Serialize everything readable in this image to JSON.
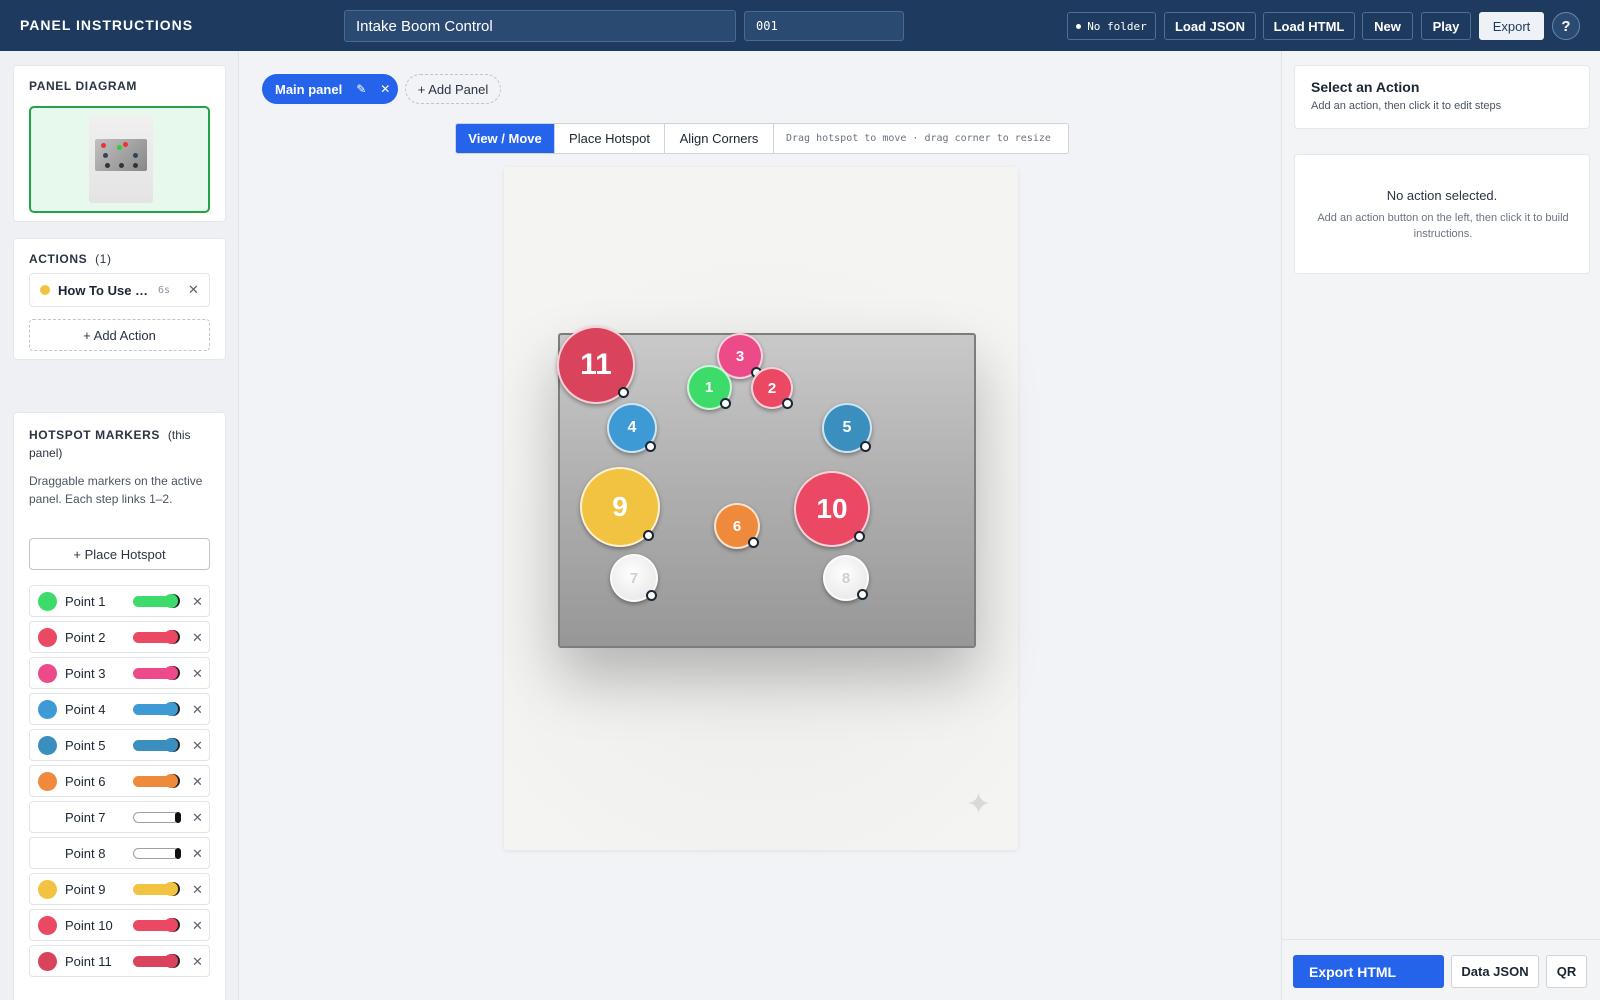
{
  "header": {
    "brand": "PANEL INSTRUCTIONS",
    "title_value": "Intake Boom Control",
    "id_value": "001",
    "folder": "No folder",
    "load_json": "Load JSON",
    "load_html": "Load HTML",
    "new": "New",
    "play": "Play",
    "export": "Export",
    "help": "?"
  },
  "left": {
    "diagram_title": "PANEL DIAGRAM",
    "actions_title": "ACTIONS",
    "actions_count": "(1)",
    "actions": [
      {
        "name": "How To Use This Panel",
        "duration": "6s"
      }
    ],
    "add_action": "+ Add Action",
    "markers_title": "HOTSPOT MARKERS",
    "markers_scope": "(this panel)",
    "markers_desc": "Draggable markers on the active panel. Each step links 1–2.",
    "place_hotspot": "+ Place Hotspot",
    "markers": [
      {
        "label": "Point 1",
        "color": "#3ddc6a",
        "enabled": true
      },
      {
        "label": "Point 2",
        "color": "#ea4863",
        "enabled": true
      },
      {
        "label": "Point 3",
        "color": "#ec4a88",
        "enabled": true
      },
      {
        "label": "Point 4",
        "color": "#3d9ad4",
        "enabled": true
      },
      {
        "label": "Point 5",
        "color": "#3b8fbe",
        "enabled": true
      },
      {
        "label": "Point 6",
        "color": "#ef8a3c",
        "enabled": true
      },
      {
        "label": "Point 7",
        "color": "#ffffff",
        "enabled": false
      },
      {
        "label": "Point 8",
        "color": "#ffffff",
        "enabled": false
      },
      {
        "label": "Point 9",
        "color": "#f2c341",
        "enabled": true
      },
      {
        "label": "Point 10",
        "color": "#ea4863",
        "enabled": true
      },
      {
        "label": "Point 11",
        "color": "#d9435c",
        "enabled": true
      }
    ]
  },
  "center": {
    "tab_label": "Main panel",
    "add_panel": "+ Add Panel",
    "modes": [
      "View / Move",
      "Place Hotspot",
      "Align Corners"
    ],
    "active_mode": "View / Move",
    "mode_hint": "Drag hotspot to move · drag corner to resize",
    "hotspots": [
      "11",
      "3",
      "1",
      "2",
      "4",
      "5",
      "9",
      "6",
      "10",
      "7",
      "8"
    ]
  },
  "right": {
    "select_title": "Select an Action",
    "select_sub": "Add an action, then click it to edit steps",
    "none_title": "No action selected.",
    "none_hint": "Add an action button on the left, then click it to build instructions.",
    "export_html": "Export HTML",
    "data_json": "Data JSON",
    "qr": "QR"
  },
  "colors": {
    "header": "#1e3a5f",
    "accent": "#2563eb",
    "diagram_border": "#23a24a"
  }
}
